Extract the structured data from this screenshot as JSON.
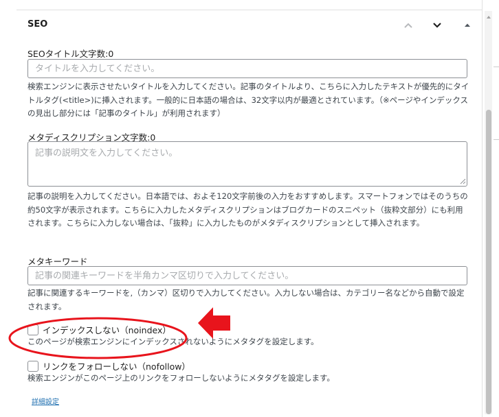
{
  "seo_panel": {
    "title": "SEO",
    "move_up_label": "Move up",
    "move_down_label": "Move down",
    "collapse_label": "Toggle panel"
  },
  "title_field": {
    "label": "SEOタイトル文字数:0",
    "placeholder": "タイトルを入力してください。",
    "value": "",
    "help": "検索エンジンに表示させたいタイトルを入力してください。記事のタイトルより、こちらに入力したテキストが優先的にタイトルタグ(<title>)に挿入されます。一般的に日本語の場合は、32文字以内が最適とされています。（※ページやインデックスの見出し部分には「記事のタイトル」が利用されます）"
  },
  "description_field": {
    "label": "メタディスクリプション文字数:0",
    "placeholder": "記事の説明文を入力してください。",
    "value": "",
    "help": "記事の説明を入力してください。日本語では、およそ120文字前後の入力をおすすめします。スマートフォンではそのうちの約50文字が表示されます。こちらに入力したメタディスクリプションはブログカードのスニペット（抜粋文部分）にも利用されます。こちらに入力しない場合は、「抜粋」に入力したものがメタディスクリプションとして挿入されます。"
  },
  "keywords_field": {
    "label": "メタキーワード",
    "placeholder": "記事の関連キーワードを半角カンマ区切りで入力してください。",
    "value": "",
    "help": "記事に関連するキーワードを,（カンマ）区切りで入力してください。入力しない場合は、カテゴリー名などから自動で設定されます。"
  },
  "noindex": {
    "label": "インデックスしない（noindex）",
    "checked": false,
    "help": "このページが検索エンジンにインデックスされないようにメタタグを設定します。"
  },
  "nofollow": {
    "label": "リンクをフォローしない（nofollow）",
    "checked": false,
    "help": "検索エンジンがこのページ上のリンクをフォローしないようにメタタグを設定します。"
  },
  "details_link": {
    "label": "詳細設定"
  },
  "colors": {
    "annotation_red": "#e8141c",
    "link_blue": "#2271b1",
    "border": "#8c8f94",
    "help_text": "#3c434a"
  }
}
